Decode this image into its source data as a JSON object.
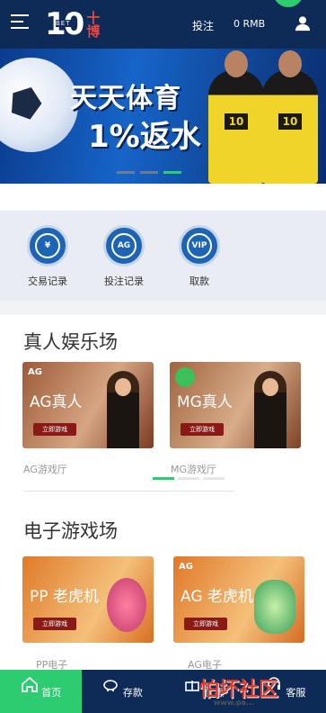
{
  "header": {
    "logo_text": "10",
    "logo_sub": "BET",
    "logo_cn": "十博",
    "bet_label": "投注",
    "balance": "0 RMB"
  },
  "banner": {
    "line1": "天天体育",
    "line2": "1%返水"
  },
  "quick_links": [
    {
      "label": "交易记录",
      "icon": "exchange-icon"
    },
    {
      "label": "投注记录",
      "icon": "ag-icon",
      "badge": "AG"
    },
    {
      "label": "取款",
      "icon": "vip-icon",
      "badge": "VIP"
    }
  ],
  "live_casino": {
    "title": "真人娱乐场",
    "cards": [
      {
        "title": "AG真人",
        "button": "立即游戏",
        "caption": "AG游戏厅",
        "badge": "AG"
      },
      {
        "title": "MG真人",
        "button": "立即游戏",
        "caption": "MG游戏厅"
      }
    ]
  },
  "slots": {
    "title": "电子游戏场",
    "cards": [
      {
        "title": "PP 老虎机",
        "button": "立即游戏",
        "caption": "PP电子"
      },
      {
        "title": "AG 老虎机",
        "button": "立即游戏",
        "caption": "AG电子",
        "badge": "AG"
      }
    ]
  },
  "bottom_nav": [
    {
      "label": "首页",
      "icon": "home-icon",
      "active": true
    },
    {
      "label": "存款",
      "icon": "piggy-bank-icon"
    },
    {
      "label": "优惠",
      "icon": "gift-icon"
    },
    {
      "label": "客服",
      "icon": "headset-icon"
    }
  ],
  "watermark": {
    "text": "怕坏社区",
    "url_text": "www.pa..."
  },
  "colors": {
    "navy": "#0e2a56",
    "green": "#2ecc71",
    "blue": "#1e64b5"
  }
}
